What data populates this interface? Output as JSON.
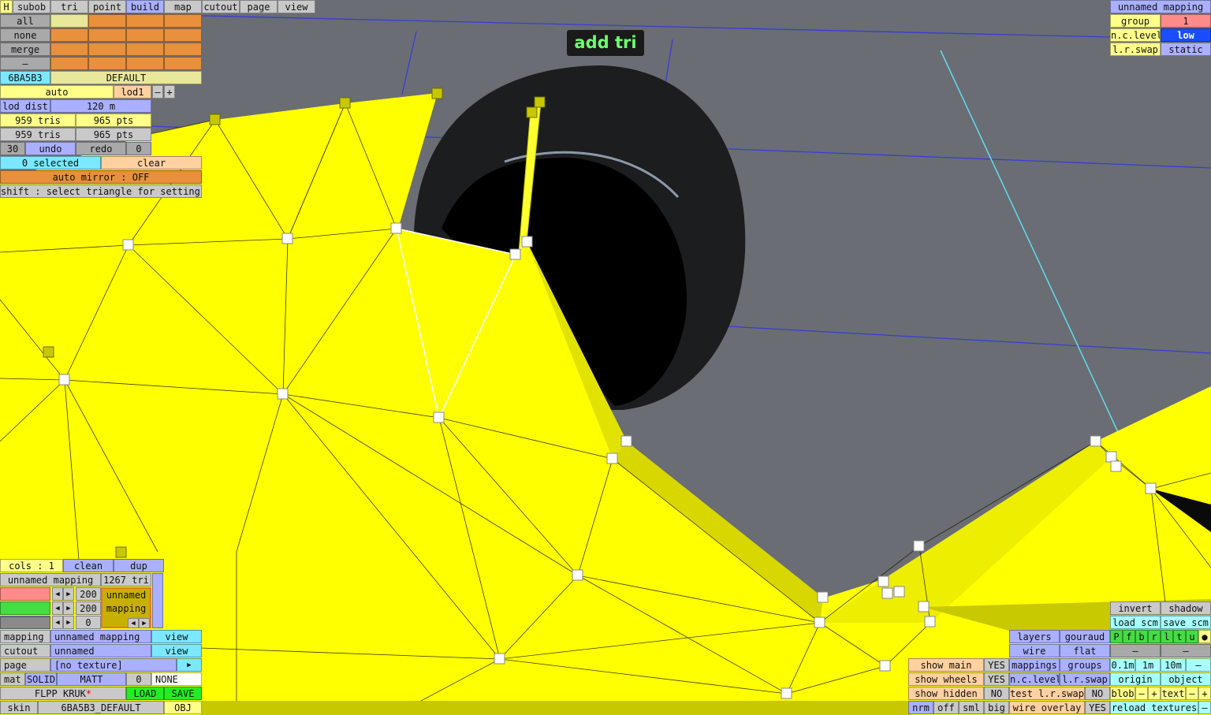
{
  "tooltip": "add tri",
  "top_tabs": [
    "H",
    "subob",
    "tri",
    "point",
    "build",
    "map",
    "cutout",
    "page",
    "view"
  ],
  "select_rows": [
    "all",
    "none",
    "merge",
    "–"
  ],
  "skin_row": {
    "hex": "6BA5B3",
    "name": "DEFAULT"
  },
  "lod": {
    "auto": "auto",
    "lod": "lod1",
    "minus": "–",
    "plus": "+",
    "dist_label": "lod dist",
    "dist_value": "120 m"
  },
  "counts": [
    {
      "tris": "959 tris",
      "pts": "965 pts"
    },
    {
      "tris": "959 tris",
      "pts": "965 pts"
    }
  ],
  "undo": {
    "left": "30",
    "undo": "undo",
    "redo": "redo",
    "right": "0"
  },
  "selection": {
    "count": "0 selected",
    "clear": "clear"
  },
  "auto_mirror": "auto mirror : OFF",
  "hint": "shift : select triangle for settings",
  "mapping_panel": {
    "title": "unnamed mapping",
    "group_label": "group",
    "group_value": "1",
    "nc_label": "n.c.level",
    "nc_value": "low",
    "swap_label": "l.r.swap",
    "swap_value": "static"
  },
  "cols": {
    "label": "cols : 1",
    "clean": "clean",
    "dup": "dup"
  },
  "mapping_info": {
    "name": "unnamed mapping",
    "tris": "1267 tri"
  },
  "texture_box": {
    "w": "200",
    "h": "200",
    "z": "0",
    "label_1": "unnamed",
    "label_2": "mapping"
  },
  "bottom_left": {
    "mapping_label": "mapping",
    "mapping_value": "unnamed mapping",
    "view_1": "view",
    "cutout_label": "cutout",
    "cutout_value": "unnamed",
    "view_2": "view",
    "page_label": "page",
    "page_value": "[no texture]",
    "page_arrow": "▶",
    "mat_label": "mat",
    "solid": "SOLID",
    "matt": "MATT",
    "mat_num": "0",
    "none": "NONE",
    "file_name": "FLPP KRUK",
    "asterisk": "*",
    "load": "LOAD",
    "save": "SAVE",
    "skin_label": "skin",
    "skin_value": "6BA5B3_DEFAULT",
    "obj": "OBJ"
  },
  "bottom_right": {
    "invert": "invert",
    "shadow": "shadow",
    "load_scm": "load scm",
    "save_scm": "save scm",
    "letters": [
      "P",
      "f",
      "b",
      "r",
      "l",
      "t",
      "u",
      "●"
    ],
    "layers": "layers",
    "gouraud": "gouraud",
    "wire": "wire",
    "flat": "flat",
    "dash": "–",
    "show_main": "show main",
    "show_main_v": "YES",
    "show_wheels": "show wheels",
    "show_wheels_v": "YES",
    "show_hidden": "show hidden",
    "show_hidden_v": "NO",
    "nrm": "nrm",
    "off": "off",
    "sml": "sml",
    "big": "big",
    "mappings": "mappings",
    "groups": "groups",
    "nclevel": "n.c.level",
    "lrswap": "l.r.swap",
    "test_swap": "test l.r.swap",
    "test_swap_v": "NO",
    "wire_overlay": "wire overlay",
    "wire_overlay_v": "YES",
    "s01": "0.1m",
    "s1": "1m",
    "s10": "10m",
    "origin": "origin",
    "object": "object",
    "blob": "blob",
    "minus": "–",
    "plus": "+",
    "text": "text",
    "reload": "reload textures"
  }
}
